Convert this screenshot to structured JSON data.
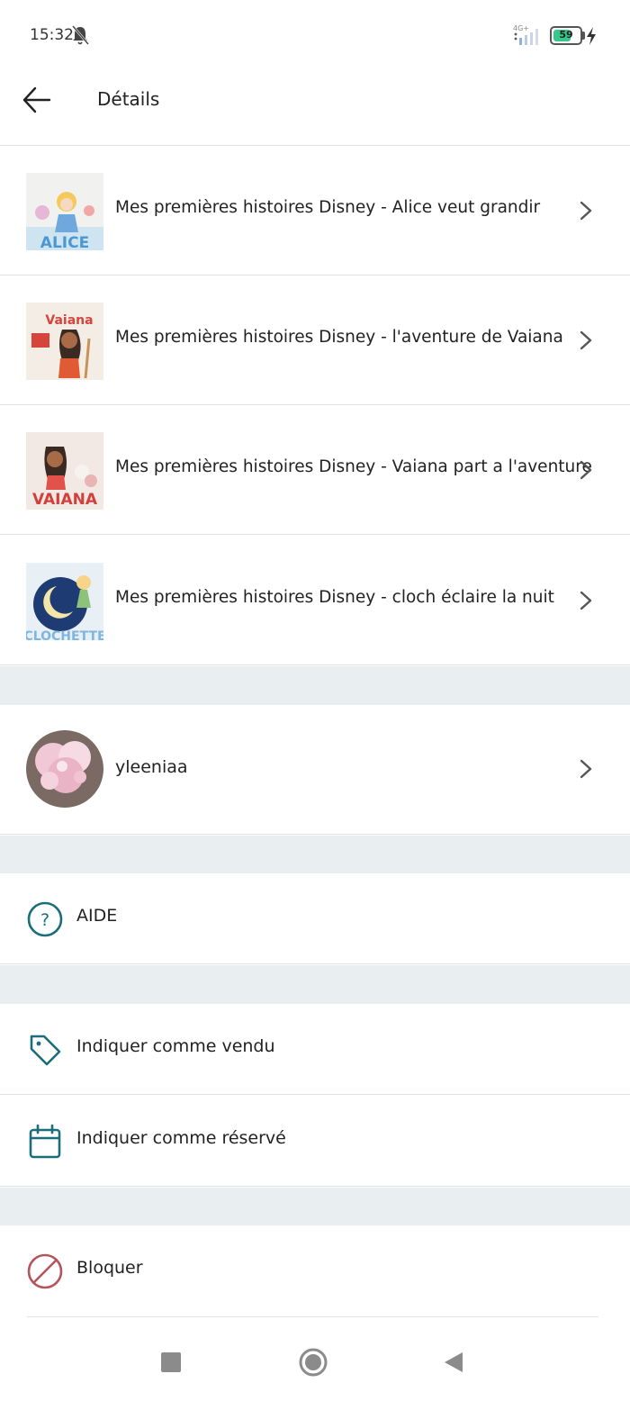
{
  "status_bar": {
    "time": "15:32",
    "network": "4G+",
    "battery_level": "59"
  },
  "app_bar": {
    "title": "Détails",
    "back_icon": "arrow-left-icon"
  },
  "items": [
    {
      "title": "Mes premières histoires Disney - Alice veut grandir",
      "cover_text": "ALICE"
    },
    {
      "title": "Mes premières histoires Disney - l'aventure de Vaiana",
      "cover_text": "Vaiana"
    },
    {
      "title": "Mes premières histoires Disney - Vaiana part a l'aventure",
      "cover_text": "VAIANA"
    },
    {
      "title": "Mes premières histoires Disney - cloch éclaire la nuit",
      "cover_text": "CLOCHETTE"
    }
  ],
  "seller": {
    "username": "yleeniaa"
  },
  "help": {
    "label": "AIDE",
    "icon": "question-circle-icon"
  },
  "actions": {
    "mark_sold": "Indiquer comme vendu",
    "mark_reserved": "Indiquer comme réservé",
    "block": "Bloquer"
  },
  "colors": {
    "accent": "#1a6e7a",
    "danger": "#b5545c",
    "separator": "#e9eff0"
  }
}
